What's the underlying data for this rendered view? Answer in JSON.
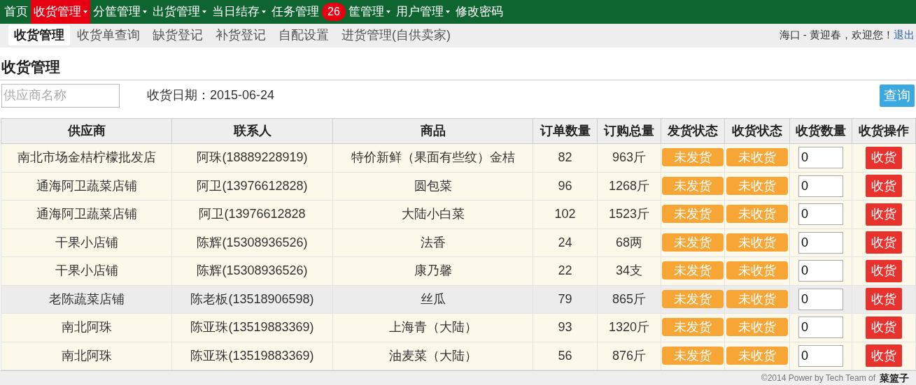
{
  "nav": [
    {
      "label": "首页",
      "dropdown": false,
      "selected": false
    },
    {
      "label": "收货管理",
      "dropdown": true,
      "selected": true
    },
    {
      "label": "分筐管理",
      "dropdown": true,
      "selected": false
    },
    {
      "label": "出货管理",
      "dropdown": true,
      "selected": false
    },
    {
      "label": "当日结存",
      "dropdown": true,
      "selected": false
    },
    {
      "label": "任务管理",
      "dropdown": false,
      "selected": false,
      "badge": "26"
    },
    {
      "label": "筐管理",
      "dropdown": true,
      "selected": false
    },
    {
      "label": "用户管理",
      "dropdown": true,
      "selected": false
    },
    {
      "label": "修改密码",
      "dropdown": false,
      "selected": false
    }
  ],
  "subnav": [
    {
      "label": "收货管理",
      "selected": true
    },
    {
      "label": "收货单查询",
      "selected": false
    },
    {
      "label": "缺货登记",
      "selected": false
    },
    {
      "label": "补货登记",
      "selected": false
    },
    {
      "label": "自配设置",
      "selected": false
    },
    {
      "label": "进货管理(自供卖家)",
      "selected": false
    }
  ],
  "user": {
    "greeting": "海口 - 黄迎春，欢迎您！",
    "logout": "退出"
  },
  "page_title": "收货管理",
  "search": {
    "placeholder": "供应商名称"
  },
  "date_label": "收货日期：2015-06-24",
  "query_button": "查询",
  "table": {
    "columns": [
      "供应商",
      "联系人",
      "商品",
      "订单数量",
      "订购总量",
      "发货状态",
      "收货状态",
      "收货数量",
      "收货操作"
    ],
    "rows": [
      {
        "supplier": "南北市场金桔柠檬批发店",
        "contact": "阿珠(18889228919)",
        "product": "特价新鲜（果面有些纹）金桔",
        "orders": "82",
        "total": "963斤",
        "ship": "未发货",
        "receive": "未收货",
        "qty": "0",
        "action": "收货",
        "selected": false
      },
      {
        "supplier": "通海阿卫蔬菜店铺",
        "contact": "阿卫(13976612828)",
        "product": "圆包菜",
        "orders": "96",
        "total": "1268斤",
        "ship": "未发货",
        "receive": "未收货",
        "qty": "0",
        "action": "收货",
        "selected": false
      },
      {
        "supplier": "通海阿卫蔬菜店铺",
        "contact": "阿卫(13976612828",
        "product": "大陆小白菜",
        "orders": "102",
        "total": "1523斤",
        "ship": "未发货",
        "receive": "未收货",
        "qty": "0",
        "action": "收货",
        "selected": false
      },
      {
        "supplier": "干果小店铺",
        "contact": "陈辉(15308936526)",
        "product": "法香",
        "orders": "24",
        "total": "68两",
        "ship": "未发货",
        "receive": "未收货",
        "qty": "0",
        "action": "收货",
        "selected": false
      },
      {
        "supplier": "干果小店铺",
        "contact": "陈辉(15308936526)",
        "product": "康乃馨",
        "orders": "22",
        "total": "34支",
        "ship": "未发货",
        "receive": "未收货",
        "qty": "0",
        "action": "收货",
        "selected": false
      },
      {
        "supplier": "老陈蔬菜店铺",
        "contact": "陈老板(13518906598)",
        "product": "丝瓜",
        "orders": "79",
        "total": "865斤",
        "ship": "未发货",
        "receive": "未收货",
        "qty": "0",
        "action": "收货",
        "selected": true
      },
      {
        "supplier": "南北阿珠",
        "contact": "陈亚珠(13519883369)",
        "product": "上海青（大陆）",
        "orders": "93",
        "total": "1320斤",
        "ship": "未发货",
        "receive": "未收货",
        "qty": "0",
        "action": "收货",
        "selected": false
      },
      {
        "supplier": "南北阿珠",
        "contact": "陈亚珠(13519883369)",
        "product": "油麦菜（大陆）",
        "orders": "56",
        "total": "876斤",
        "ship": "未发货",
        "receive": "未收货",
        "qty": "0",
        "action": "收货",
        "selected": false
      }
    ]
  },
  "footer": {
    "text": "©2014  Power by Tech Team of",
    "logo": "菜篮子"
  }
}
